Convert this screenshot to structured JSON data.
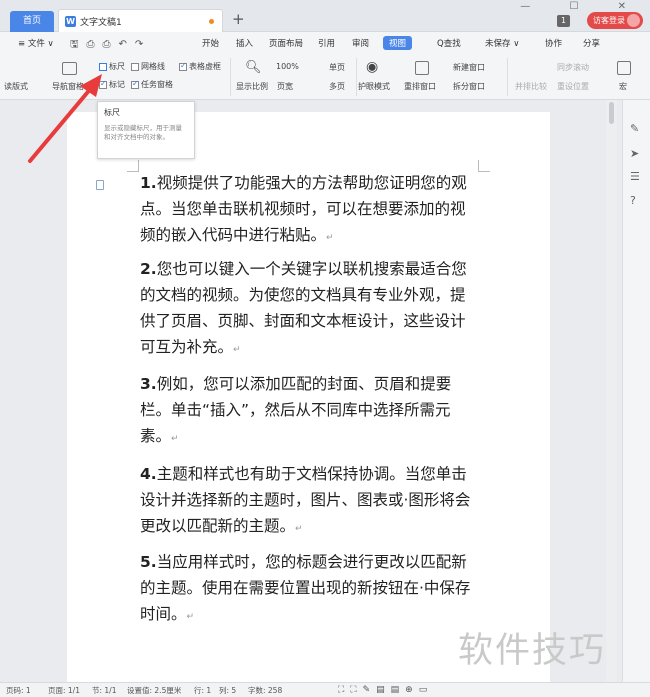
{
  "titlebar": {
    "home_tab": "首页",
    "doc_tab": "文字文稿1",
    "add_tab": "+",
    "page_badge": "1",
    "login_button": "访客登录",
    "win_controls": "— ☐ ✕"
  },
  "menubar": {
    "file": "≡ 文件 ∨",
    "tabs": [
      "开始",
      "插入",
      "页面布局",
      "引用",
      "审阅",
      "视图"
    ],
    "active_tab": "视图",
    "search": "Q查找",
    "unsaved": "未保存 ∨",
    "collab": "协作",
    "share": "分享"
  },
  "ribbon": {
    "reading_view": "读版式",
    "nav_pane": "导航窗格",
    "ruler": "标尺",
    "gridlines": "网格线",
    "table_borders": "表格虚框",
    "markup": "标记",
    "task_pane": "任务窗格",
    "zoom_label": "显示比例",
    "zoom_value": "100%",
    "single_page": "单页",
    "page_width": "页宽",
    "multi_page": "多页",
    "eye_mode": "护眼模式",
    "arrange": "重排窗口",
    "new_window": "新建窗口",
    "split_window": "拆分窗口",
    "side_by_side": "并排比较",
    "sync_scroll": "同步滚动",
    "reset_pos": "重设位置",
    "macro": "宏"
  },
  "tooltip": {
    "title": "标尺",
    "description": "显示或隐藏标尺，用于测量和对齐文档中的对象。"
  },
  "document": {
    "items": [
      {
        "num": "1.",
        "text": "视频提供了功能强大的方法帮助您证明您的观点。当您单击联机视频时，可以在想要添加的视频的嵌入代码中进行粘贴。"
      },
      {
        "num": "2.",
        "text": "您也可以键入一个关键字以联机搜索最适合您的文档的视频。为使您的文档具有专业外观，提供了页眉、页脚、封面和文本框设计，这些设计可互为补充。"
      },
      {
        "num": "3.",
        "text": "例如，您可以添加匹配的封面、页眉和提要栏。单击“插入”，然后从不同库中选择所需元素。"
      },
      {
        "num": "4.",
        "text": "主题和样式也有助于文档保持协调。当您单击设计并选择新的主题时，图片、图表或·图形将会更改以匹配新的主题。"
      },
      {
        "num": "5.",
        "text": "当应用样式时，您的标题会进行更改以匹配新的主题。使用在需要位置出现的新按钮在·中保存时间。"
      }
    ],
    "para_mark": "↵"
  },
  "statusbar": {
    "page": "页码: 1",
    "pages": "页面: 1/1",
    "section": "节: 1/1",
    "setting": "设置值: 2.5厘米",
    "row": "行: 1",
    "col": "列: 5",
    "words": "字数: 258"
  },
  "watermark": "软件技巧"
}
